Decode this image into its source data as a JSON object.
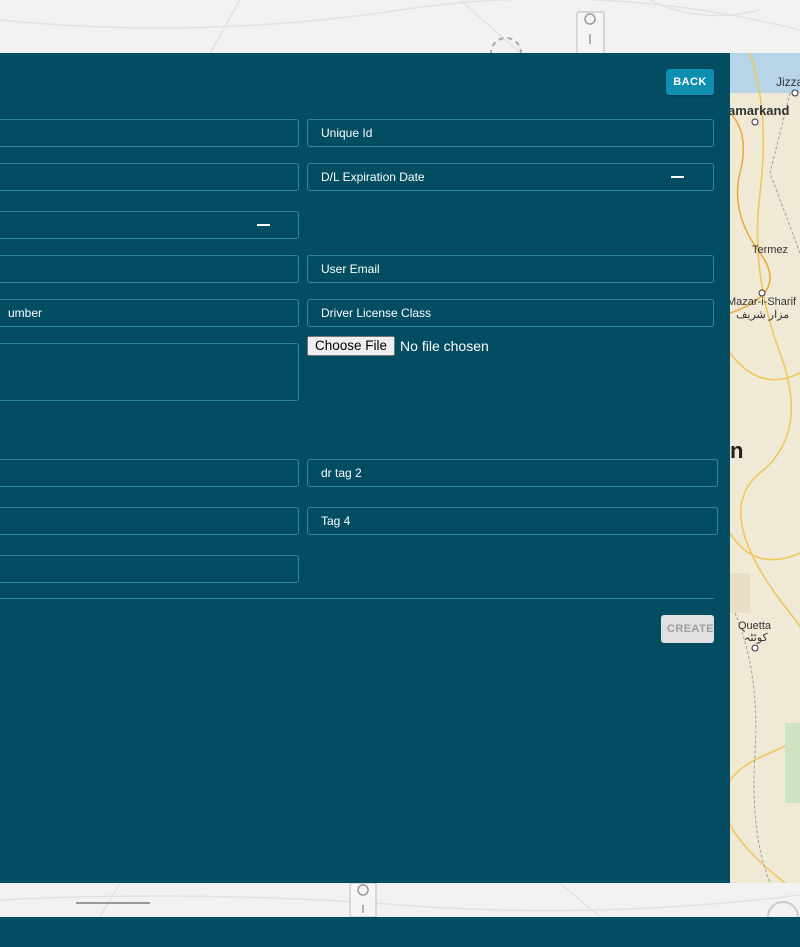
{
  "header": {
    "back_label": "BACK"
  },
  "form": {
    "left_fields": [
      "",
      "",
      "",
      "",
      "umber",
      "",
      "",
      "",
      ""
    ],
    "unique_id": "Unique Id",
    "dl_expiration_date": "D/L Expiration Date",
    "user_email": "User Email",
    "driver_license_class": "Driver License Class",
    "file_input": {
      "button": "Choose File",
      "status": "No file chosen"
    },
    "tag2": "dr tag 2",
    "tag4": "Tag 4",
    "create_label": "CREATE"
  },
  "map": {
    "labels": [
      "amarkand",
      "Jizza",
      "Termez",
      "Mazar-i-Sharif",
      "مزار شریف",
      "n",
      "Quetta",
      "کوئٹہ"
    ]
  },
  "colors": {
    "panel": "#034d63",
    "accent": "#0e8fb1",
    "field_border": "#2c88a4"
  }
}
